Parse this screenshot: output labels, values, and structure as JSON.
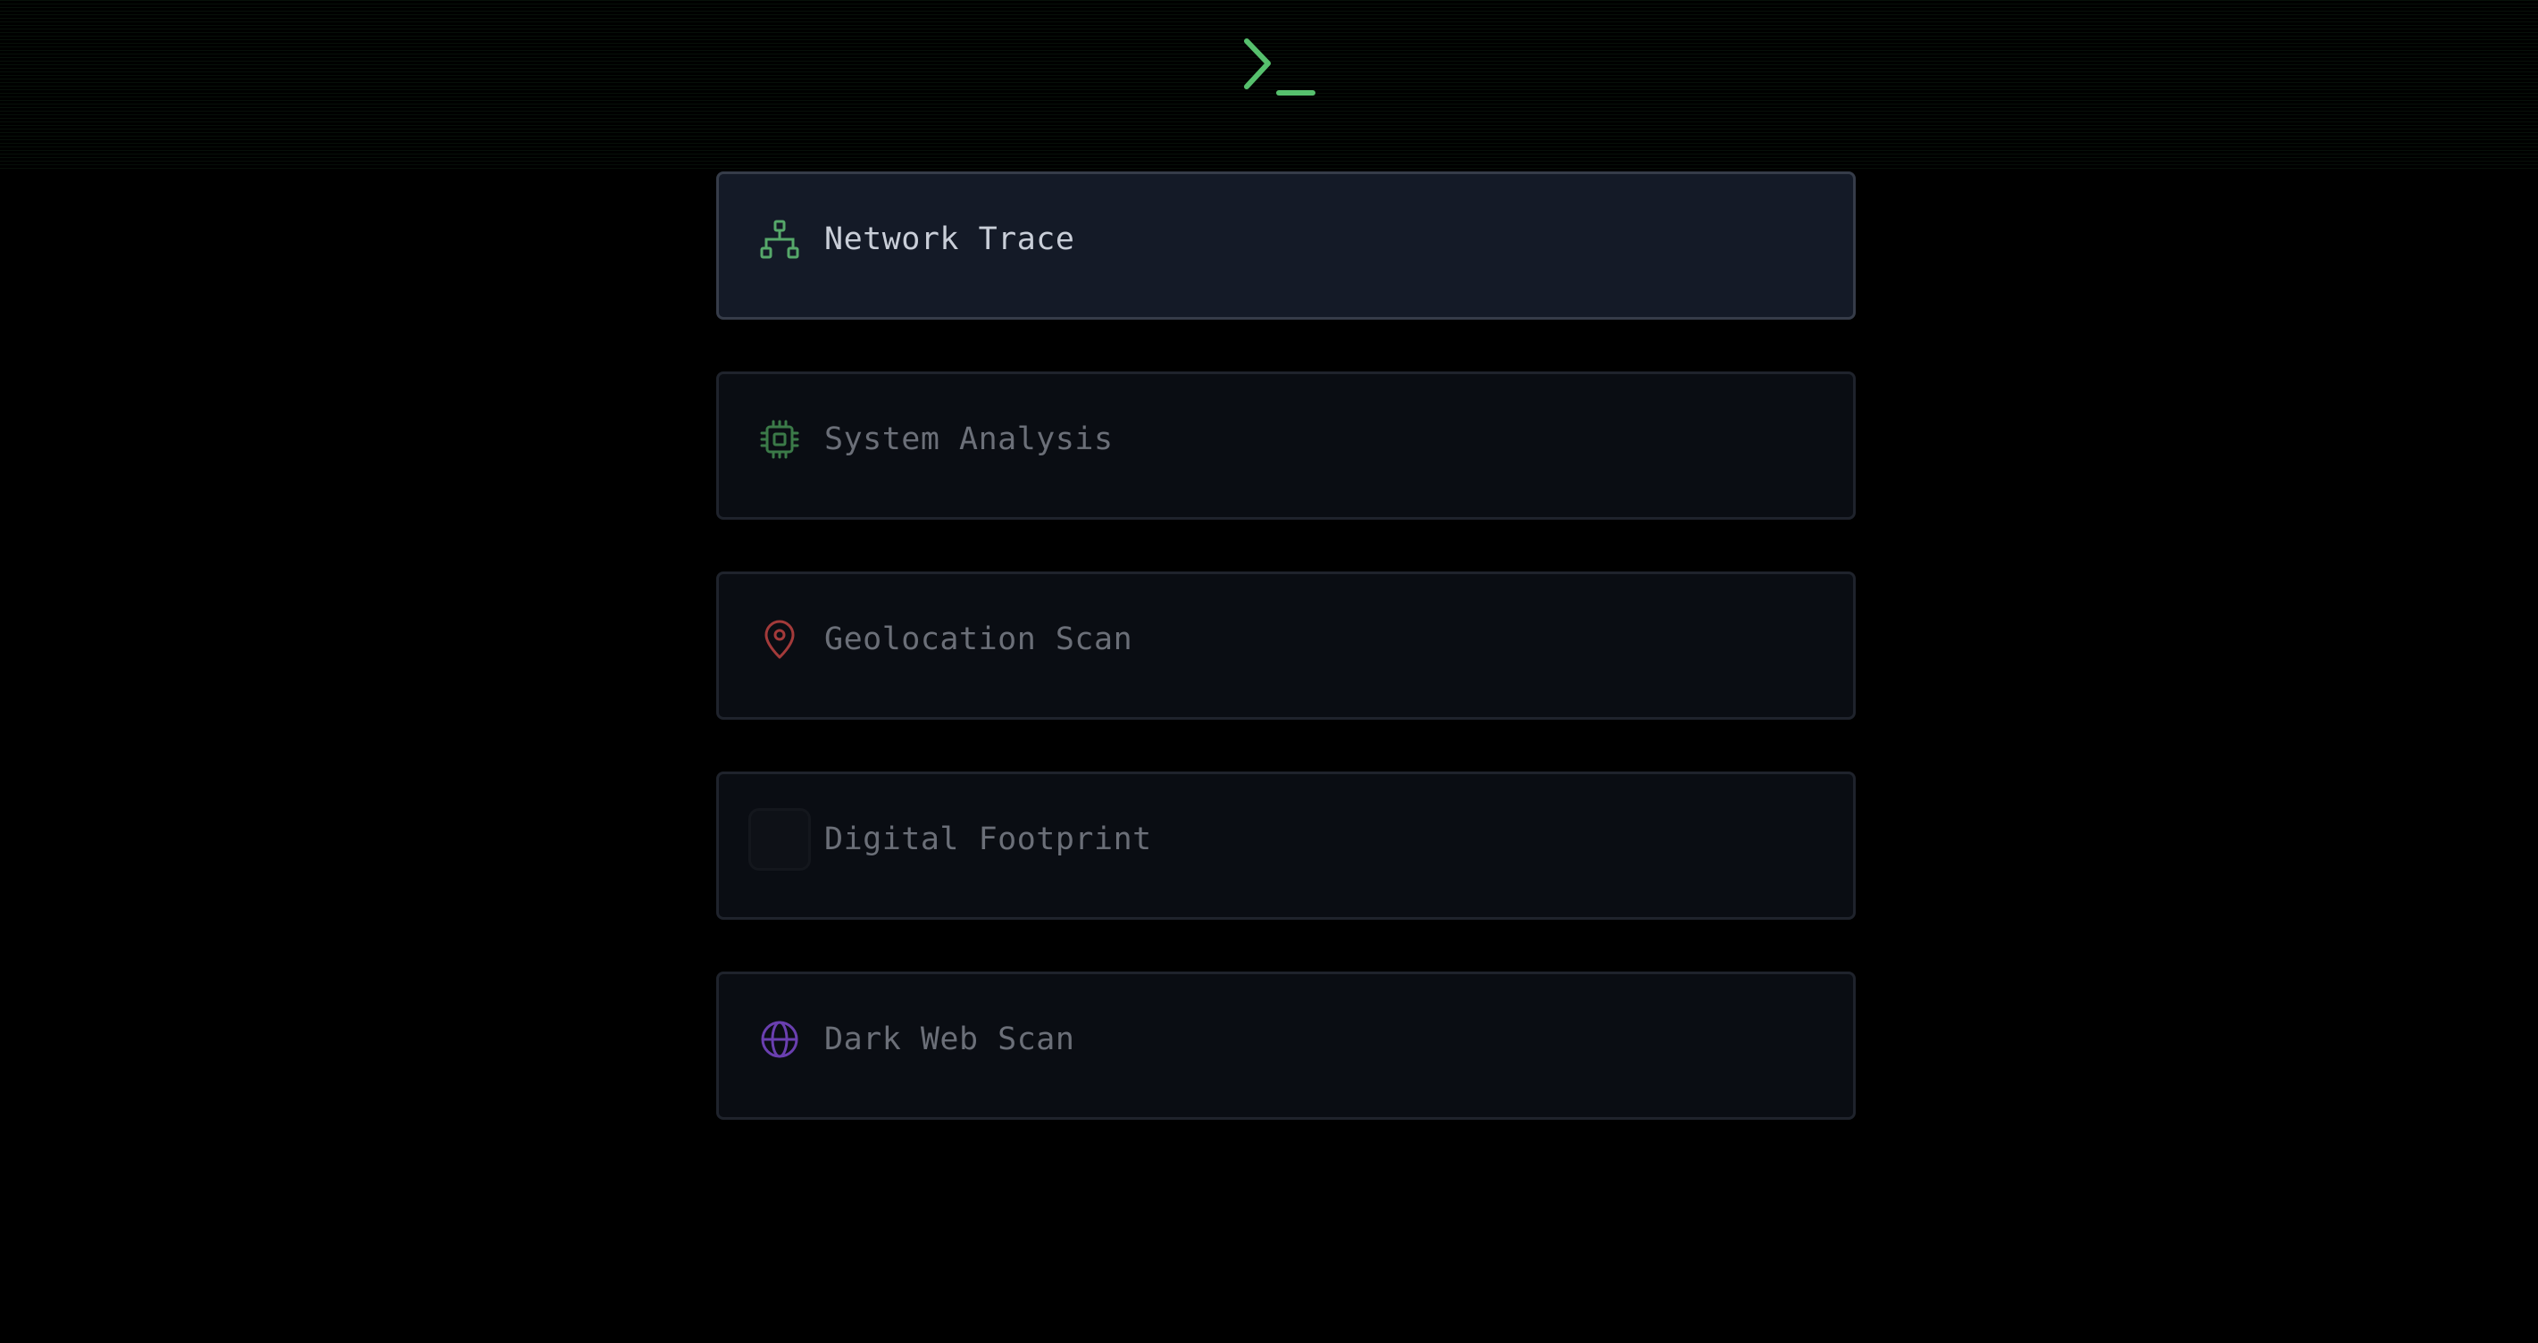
{
  "header": {
    "logo_icon": "terminal-prompt-icon",
    "accent_color": "#56c06d"
  },
  "menu": {
    "items": [
      {
        "label": "Network Trace",
        "icon": "network-icon",
        "icon_color": "#56a86a",
        "active": true
      },
      {
        "label": "System Analysis",
        "icon": "cpu-icon",
        "icon_color": "#3b7a48",
        "active": false
      },
      {
        "label": "Geolocation Scan",
        "icon": "map-pin-icon",
        "icon_color": "#a33a3a",
        "active": false
      },
      {
        "label": "Digital Footprint",
        "icon": "loading-placeholder",
        "icon_color": "#14171d",
        "active": false
      },
      {
        "label": "Dark Web Scan",
        "icon": "globe-icon",
        "icon_color": "#6a3fb0",
        "active": false
      }
    ]
  }
}
